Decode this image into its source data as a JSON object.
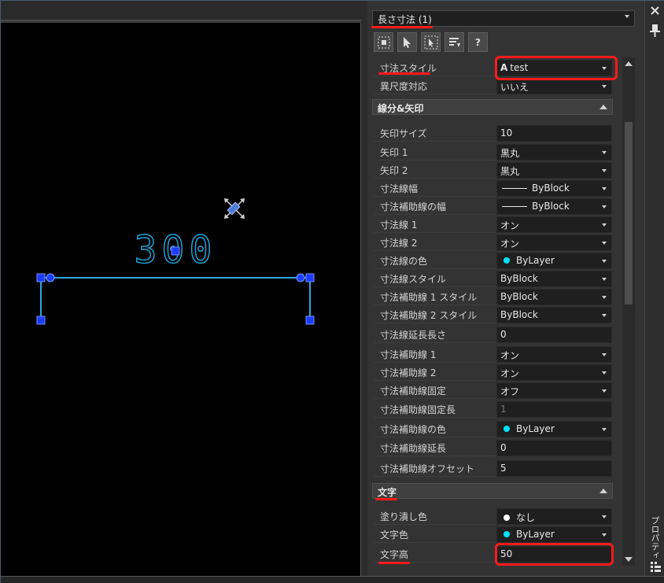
{
  "canvas": {
    "dimension_value": "300",
    "colors": {
      "dim_line": "#2aa7e0",
      "grip": "#1e3cff",
      "text": "#1fa0d6"
    }
  },
  "panel": {
    "selector": "長さ寸法 (1)",
    "toolbar": [
      "quick-select-icon",
      "select-objects-icon",
      "pick-add-icon",
      "filter-icon",
      "help-icon"
    ],
    "help_label": "?",
    "general": [
      {
        "label": "寸法スタイル",
        "value": "test"
      },
      {
        "label": "異尺度対応",
        "value": "いいえ"
      }
    ],
    "lines_section": "線分&矢印",
    "lines": [
      {
        "label": "矢印サイズ",
        "value": "10"
      },
      {
        "label": "矢印 1",
        "value": "黒丸"
      },
      {
        "label": "矢印 2",
        "value": "黒丸"
      },
      {
        "label": "寸法線幅",
        "value": "ByBlock"
      },
      {
        "label": "寸法補助線の幅",
        "value": "ByBlock"
      },
      {
        "label": "寸法線 1",
        "value": "オン"
      },
      {
        "label": "寸法線 2",
        "value": "オン"
      },
      {
        "label": "寸法線の色",
        "value": "ByLayer"
      },
      {
        "label": "寸法線スタイル",
        "value": "ByBlock"
      },
      {
        "label": "寸法補助線 1 スタイル",
        "value": "ByBlock"
      },
      {
        "label": "寸法補助線 2 スタイル",
        "value": "ByBlock"
      },
      {
        "label": "寸法線延長長さ",
        "value": "0"
      },
      {
        "label": "寸法補助線 1",
        "value": "オン"
      },
      {
        "label": "寸法補助線 2",
        "value": "オン"
      },
      {
        "label": "寸法補助線固定",
        "value": "オフ"
      },
      {
        "label": "寸法補助線固定長",
        "value": "1"
      },
      {
        "label": "寸法補助線の色",
        "value": "ByLayer"
      },
      {
        "label": "寸法補助線延長",
        "value": "0"
      },
      {
        "label": "寸法補助線オフセット",
        "value": "5"
      }
    ],
    "text_section": "文字",
    "text": [
      {
        "label": "塗り潰し色",
        "value": "なし"
      },
      {
        "label": "文字色",
        "value": "ByLayer"
      },
      {
        "label": "文字高",
        "value": "50"
      }
    ],
    "colors": {
      "cyan": "#00e5ff",
      "white": "#ffffff",
      "highlight": "#ff1a1a"
    }
  },
  "sidebar": {
    "tab_label": "プロパティ"
  }
}
